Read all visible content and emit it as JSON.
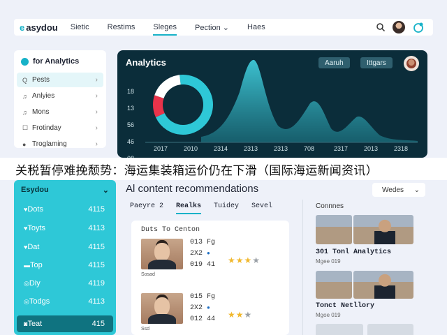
{
  "topbar": {
    "logo_mark": "e",
    "logo_text": "asydou",
    "nav": [
      "Sietic",
      "Restims",
      "Sleges",
      "Pection",
      "Haes"
    ],
    "pection_chevron": "⌄"
  },
  "sidebar": {
    "title": "for Analytics",
    "items": [
      {
        "icon": "Q",
        "label": "Pests"
      },
      {
        "icon": "♫",
        "label": "Anlyies"
      },
      {
        "icon": "♫",
        "label": "Mons"
      },
      {
        "icon": "☐",
        "label": "Frotinday"
      },
      {
        "icon": "●",
        "label": "Troglaming"
      }
    ]
  },
  "dashboard": {
    "title": "Analytics",
    "pill1": "Aaruh",
    "pill2": "Ittgars",
    "y_ticks": [
      "18",
      "13",
      "56",
      "46",
      "08"
    ],
    "x_ticks": [
      "2017",
      "2010",
      "2314",
      "2313",
      "2313",
      "708",
      "2317",
      "2013",
      "2318"
    ]
  },
  "banner": {
    "headline": "关税暂停难挽颓势：海运集装箱运价仍在下滑（国际海运新闻资讯）"
  },
  "panel2": {
    "title": "Esydou",
    "chevron": "⌄",
    "items": [
      {
        "icon": "♥",
        "label": "Dots",
        "value": "4115"
      },
      {
        "icon": "♥",
        "label": "Toyts",
        "value": "4113"
      },
      {
        "icon": "♥",
        "label": "Dat",
        "value": "4115"
      },
      {
        "icon": "▬",
        "label": "Top",
        "value": "4115"
      },
      {
        "icon": "◎",
        "label": "Diy",
        "value": "4119"
      },
      {
        "icon": "◎",
        "label": "Todgs",
        "value": "4113"
      },
      {
        "icon": "◙",
        "label": "Teat",
        "value": "415"
      }
    ]
  },
  "recs": {
    "title": "Al content recommendations",
    "select": "Wedes",
    "select_chevron": "⌄",
    "tabs": [
      "Paeyre 2",
      "Realks",
      "Tuidey",
      "Sevel"
    ],
    "card_title": "Duts To Centon",
    "rows": [
      {
        "l1": "013 Fg",
        "l2": "2X2",
        "l3": "019 41",
        "cap": "Sosad"
      },
      {
        "l1": "015 Fg",
        "l2": "2X2",
        "l3": "012 44",
        "cap": "Ssd"
      }
    ]
  },
  "connections": {
    "title": "Connnes",
    "items": [
      {
        "title": "301 Tonl Analytics",
        "sub": "Mgee 019"
      },
      {
        "title": "Tonct Netllory",
        "sub": "Mgoe 019"
      }
    ]
  },
  "chart_data": [
    {
      "type": "pie",
      "title": "",
      "slices": [
        {
          "color": "#2ec8d7",
          "value": 0.7
        },
        {
          "color": "#e8334a",
          "value": 0.12
        },
        {
          "color": "#ffffff",
          "value": 0.18
        }
      ]
    },
    {
      "type": "area",
      "title": "",
      "x": [
        "2017",
        "2010",
        "2314",
        "2313",
        "2313",
        "708",
        "2317",
        "2013",
        "2318"
      ],
      "y_ticks": [
        "18",
        "13",
        "56",
        "46",
        "08"
      ],
      "color": "#2ec8d7"
    }
  ]
}
